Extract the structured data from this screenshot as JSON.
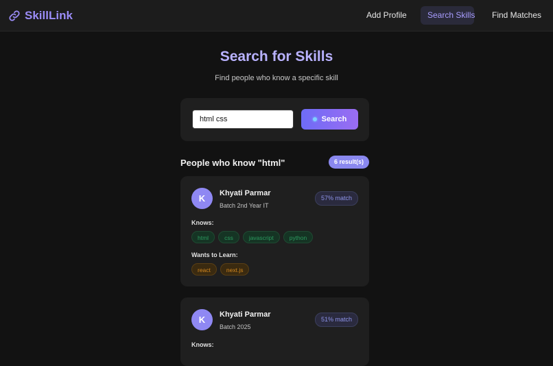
{
  "app": {
    "brand": "SkillLink",
    "brand_icon": "link-icon",
    "accent_color": "#9b8cf7"
  },
  "nav": {
    "items": [
      {
        "label": "Add Profile",
        "active": false
      },
      {
        "label": "Search Skills",
        "active": true
      },
      {
        "label": "Find Matches",
        "active": false
      }
    ]
  },
  "page": {
    "title": "Search for Skills",
    "subtitle": "Find people who know a specific skill"
  },
  "search": {
    "value": "html css",
    "button_label": "Search"
  },
  "results": {
    "title": "People who know \"html\"",
    "count_label": "6 result(s)",
    "profiles": [
      {
        "initial": "K",
        "name": "Khyati Parmar",
        "batch": "Batch 2nd Year IT",
        "match": "57% match",
        "knows_label": "Knows:",
        "knows": [
          "html",
          "css",
          "javascript",
          "python"
        ],
        "learn_label": "Wants to Learn:",
        "learn": [
          "react",
          "next.js"
        ]
      },
      {
        "initial": "K",
        "name": "Khyati Parmar",
        "batch": "Batch 2025",
        "match": "51% match",
        "knows_label": "Knows:"
      }
    ]
  }
}
